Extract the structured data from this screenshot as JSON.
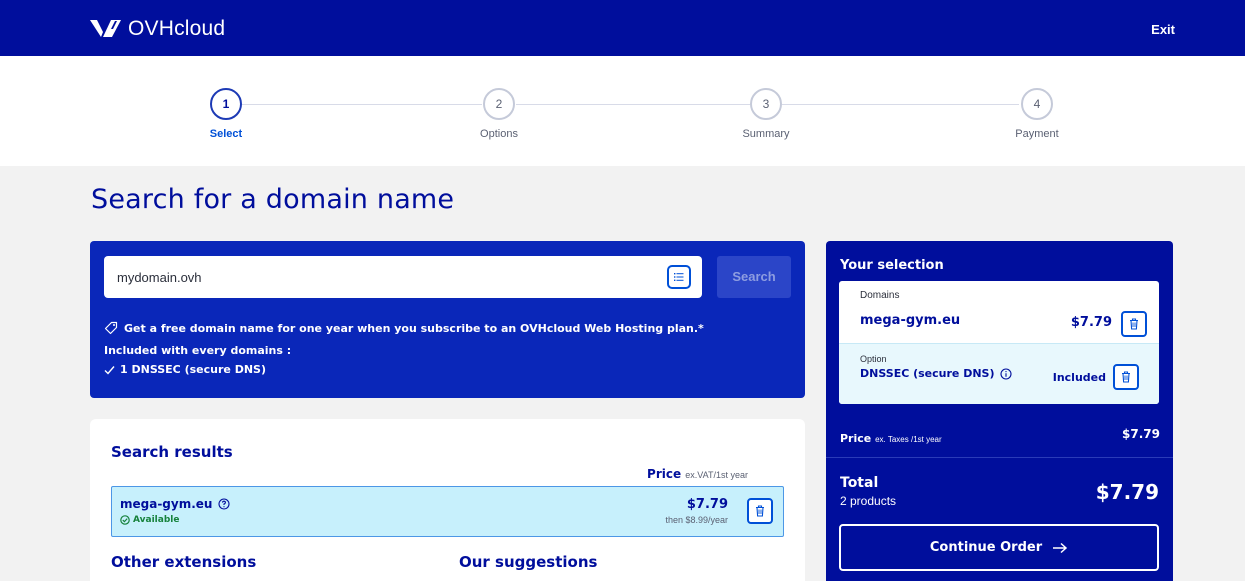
{
  "header": {
    "logo_text": "OVHcloud",
    "exit_label": "Exit"
  },
  "stepper": {
    "steps": [
      {
        "number": "1",
        "label": "Select",
        "active": true
      },
      {
        "number": "2",
        "label": "Options",
        "active": false
      },
      {
        "number": "3",
        "label": "Summary",
        "active": false
      },
      {
        "number": "4",
        "label": "Payment",
        "active": false
      }
    ]
  },
  "page": {
    "title": "Search for a domain name"
  },
  "search": {
    "input_value": "mydomain.ovh",
    "button_label": "Search",
    "promo_text": "Get a free domain name for one year when you subscribe to an OVHcloud Web Hosting plan.*",
    "included_title": "Included with every domains :",
    "included_item": "1 DNSSEC (secure DNS)"
  },
  "results": {
    "title": "Search results",
    "price_header": "Price",
    "price_header_sub": "ex.VAT/1st year",
    "items": [
      {
        "domain": "mega-gym.eu",
        "status": "Available",
        "price": "$7.79",
        "renewal": "then $8.99/year"
      }
    ],
    "other_extensions_title": "Other extensions",
    "suggestions_title": "Our suggestions"
  },
  "selection": {
    "title": "Your selection",
    "domains_label": "Domains",
    "domain": "mega-gym.eu",
    "domain_price": "$7.79",
    "option_label": "Option",
    "option_name": "DNSSEC (secure DNS)",
    "option_price": "Included",
    "price_label": "Price",
    "price_label_sub": "ex. Taxes /1st year",
    "price_value": "$7.79",
    "total_label": "Total",
    "total_sub": "2 products",
    "total_value": "$7.79",
    "continue_label": "Continue Order"
  },
  "colors": {
    "brand": "#000e9c",
    "accent": "#0050d7",
    "available": "#16823c",
    "result_highlight": "#c7f0fc"
  }
}
